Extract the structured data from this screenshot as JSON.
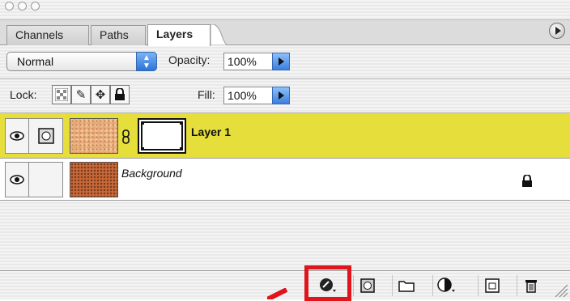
{
  "tabs": [
    {
      "label": "Channels"
    },
    {
      "label": "Paths"
    },
    {
      "label": "Layers"
    }
  ],
  "blend": {
    "mode": "Normal",
    "opacity_label": "Opacity:",
    "opacity_value": "100%"
  },
  "lock": {
    "label": "Lock:",
    "fill_label": "Fill:",
    "fill_value": "100%"
  },
  "layers": [
    {
      "name": "Layer 1",
      "selected": true
    },
    {
      "name": "Background",
      "locked": true
    }
  ],
  "colors": {
    "selected_row": "#e6de3a",
    "highlight": "#e0151b",
    "tab_bg": "#dcdcdc"
  },
  "bottom_icons": [
    "add-layer-style-icon",
    "add-mask-icon",
    "new-group-icon",
    "new-adjustment-layer-icon",
    "new-layer-icon",
    "delete-layer-icon"
  ]
}
